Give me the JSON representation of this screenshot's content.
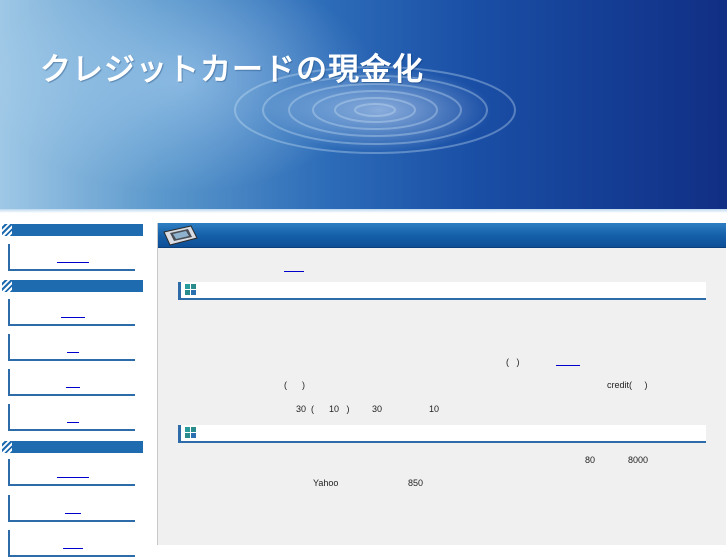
{
  "header": {
    "title": "クレジットカードの現金化"
  },
  "sidebar": {
    "groups": [
      {
        "items": [
          "",
          ""
        ]
      },
      {
        "items": [
          "",
          "",
          "",
          ""
        ]
      },
      {
        "items": [
          "",
          "",
          ""
        ]
      }
    ]
  },
  "main": {
    "fragments": {
      "para1_paren": "(   )",
      "para2_paren": "(      )",
      "para2_credit": "credit(     )",
      "para3_a": "30  (      10   )",
      "para3_b": "30",
      "para3_c": "10",
      "para4_a": "80",
      "para4_b": "8000",
      "para5_a": "Yahoo",
      "para5_b": "850"
    }
  },
  "colors": {
    "accent": "#1e6bb0",
    "link": "#0000cc",
    "content_bg": "#f0f0f0"
  },
  "icons": {
    "section": "grid-icon",
    "content_header": "device-icon"
  }
}
